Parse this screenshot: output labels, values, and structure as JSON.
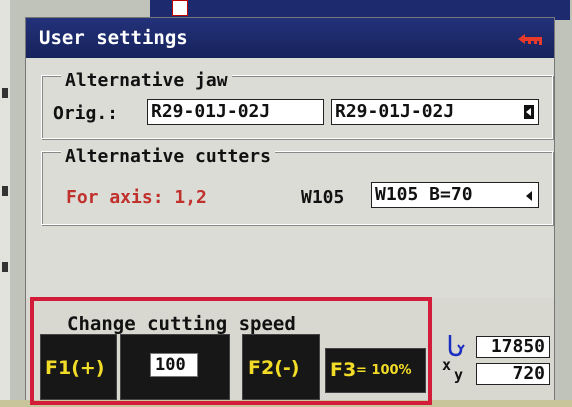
{
  "window": {
    "title": "User settings",
    "title_icon": "key-icon"
  },
  "alternative_jaw": {
    "title": "Alternative jaw",
    "orig_label": "Orig.:",
    "orig_value": "R29-01J-02J",
    "alt_value": "R29-01J-02J"
  },
  "alternative_cutters": {
    "title": "Alternative cutters",
    "axis_label": "For axis: 1,2",
    "cutter_code": "W105",
    "cutter_value": "W105 B=70"
  },
  "speed": {
    "label": "Change cutting speed",
    "f1_label": "F1(+)",
    "value": "100",
    "f2_label": "F2(-)",
    "f3_label": "F3",
    "f3_suffix": "= 100%"
  },
  "coordinates": {
    "x_label": "x",
    "y_label": "y",
    "value1": "17850",
    "value2": "720"
  },
  "colors": {
    "title_bar": "#1d2a6e",
    "highlight_frame": "#d21c3a",
    "function_key_text": "#f2dc27",
    "axis_label": "#c0302c"
  }
}
